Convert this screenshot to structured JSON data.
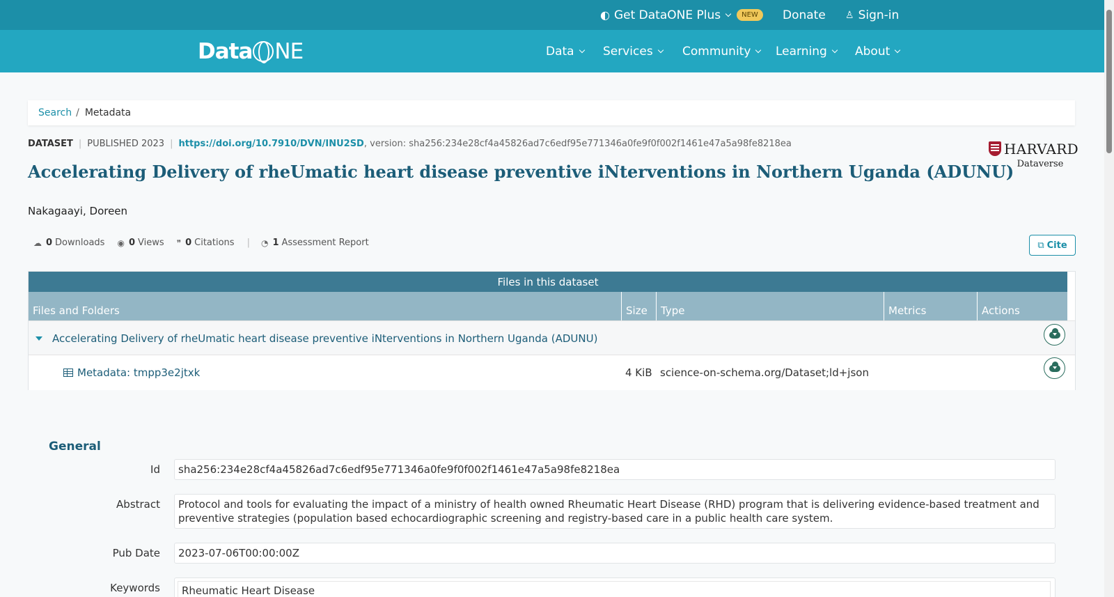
{
  "topbar": {
    "plus_label": "Get DataONE Plus",
    "new_badge": "NEW",
    "donate_label": "Donate",
    "signin_label": "Sign-in"
  },
  "nav": {
    "logo_text_bold": "Data",
    "logo_text_thin": "NE",
    "items": [
      "Data",
      "Services",
      "Community",
      "Learning",
      "About"
    ]
  },
  "breadcrumb": {
    "search": "Search",
    "separator": "/",
    "current": "Metadata"
  },
  "dataset": {
    "type_label": "DATASET",
    "published": "PUBLISHED 2023",
    "doi": "https://doi.org/10.7910/DVN/INU2SD",
    "version": ", version: sha256:234e28cf4a45826ad7c6edf95e771346a0fe9f0f002f1461e47a5a98fe8218ea",
    "title": "Accelerating Delivery of rheUmatic heart disease preventive iNterventions in Northern Uganda (ADUNU)",
    "author": "Nakagaayi, Doreen",
    "repository_line1": "HARVARD",
    "repository_line2": "Dataverse"
  },
  "stats": {
    "downloads_count": "0",
    "downloads_label": "Downloads",
    "views_count": "0",
    "views_label": "Views",
    "citations_count": "0",
    "citations_label": "Citations",
    "assessment_count": "1",
    "assessment_label": "Assessment Report",
    "cite_label": "Cite"
  },
  "files": {
    "caption": "Files in this dataset",
    "columns": [
      "Files and Folders",
      "Size",
      "Type",
      "Metrics",
      "Actions"
    ],
    "folder": {
      "name": "Accelerating Delivery of rheUmatic heart disease preventive iNterventions in Northern Uganda (ADUNU)"
    },
    "file": {
      "name": "Metadata: tmpp3e2jtxk",
      "size": "4 KiB",
      "type": "science-on-schema.org/Dataset;ld+json"
    }
  },
  "general": {
    "heading": "General",
    "id_label": "Id",
    "id_value": "sha256:234e28cf4a45826ad7c6edf95e771346a0fe9f0f002f1461e47a5a98fe8218ea",
    "abstract_label": "Abstract",
    "abstract_value": "Protocol and tools for evaluating the impact of a ministry of health owned Rheumatic Heart Disease (RHD) program that is delivering evidence-based treatment and preventive strategies (population based echocardiographic screening and registry-based care in a public health care system.",
    "pubdate_label": "Pub Date",
    "pubdate_value": "2023-07-06T00:00:00Z",
    "keywords_label": "Keywords",
    "keywords_value": "Rheumatic Heart Disease"
  },
  "colors": {
    "topbar": "#1c8fa8",
    "nav": "#23a7c1",
    "accent": "#1c8fa8",
    "title": "#1c5d78",
    "table_caption": "#3d7a93",
    "table_header": "#93b6c5"
  }
}
